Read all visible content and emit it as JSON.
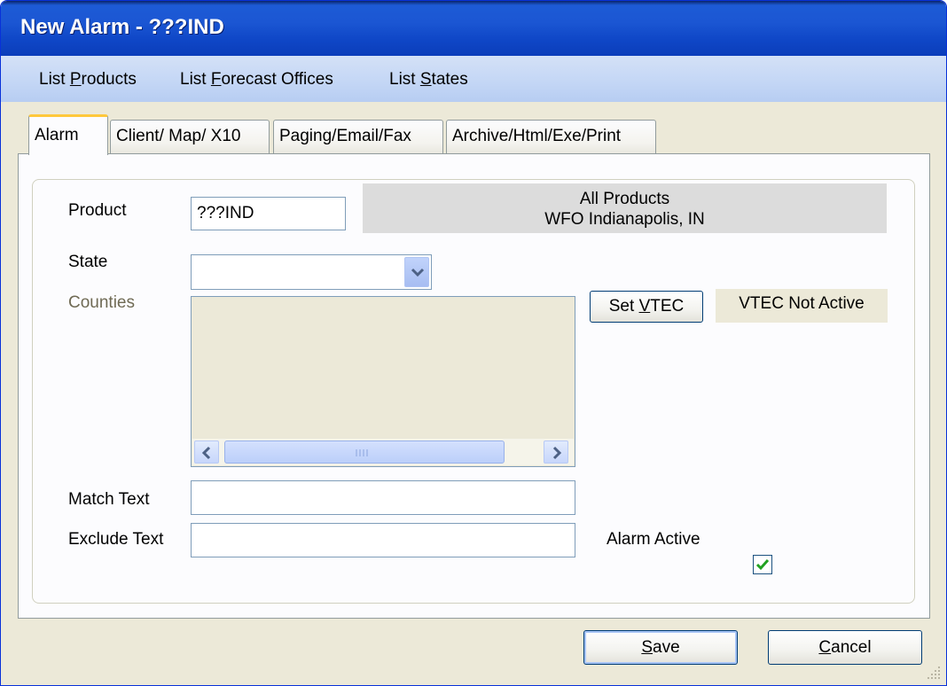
{
  "window": {
    "title": "New Alarm - ???IND"
  },
  "menu": [
    {
      "pre": "List ",
      "key": "P",
      "post": "roducts"
    },
    {
      "pre": "List ",
      "key": "F",
      "post": "orecast Offices"
    },
    {
      "pre": "List ",
      "key": "S",
      "post": "tates"
    }
  ],
  "tabs": [
    "Alarm",
    "Client/ Map/ X10",
    "Paging/Email/Fax",
    "Archive/Html/Exe/Print"
  ],
  "form": {
    "product_label": "Product",
    "product_value": "???IND",
    "info_line1": "All Products",
    "info_line2": "WFO Indianapolis, IN",
    "state_label": "State",
    "state_value": "",
    "counties_label": "Counties",
    "set_vtec_pre": "Set ",
    "set_vtec_key": "V",
    "set_vtec_post": "TEC",
    "vtec_status": "VTEC Not Active",
    "match_label": "Match Text",
    "match_value": "",
    "exclude_label": "Exclude Text",
    "exclude_value": "",
    "alarm_active_label": "Alarm Active",
    "alarm_active_checked": true
  },
  "buttons": {
    "save_key": "S",
    "save_rest": "ave",
    "cancel_key": "C",
    "cancel_rest": "ancel"
  }
}
